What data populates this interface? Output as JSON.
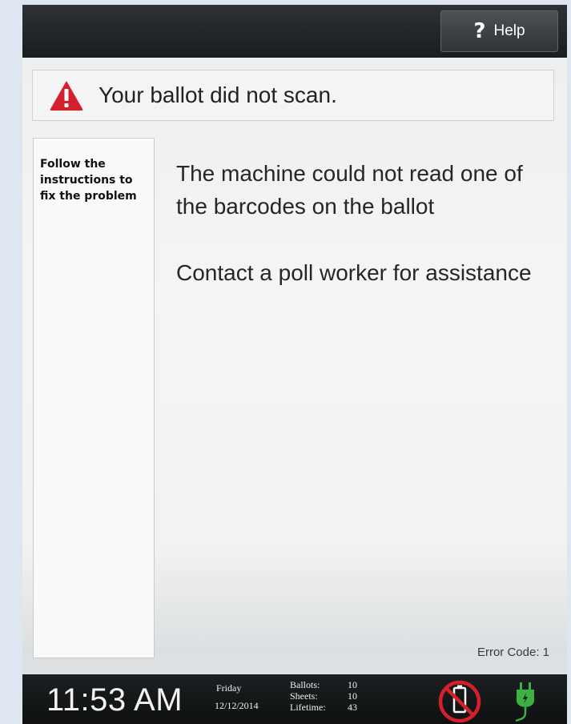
{
  "header": {
    "help_label": "Help",
    "help_icon_glyph": "?"
  },
  "status": {
    "message": "Your ballot did not scan.",
    "icon": "warning-triangle-icon",
    "icon_color": "#d4202a"
  },
  "sidebar": {
    "instruction": "Follow the instructions to fix the problem"
  },
  "main": {
    "paragraphs": [
      "The machine could not read one of the barcodes on the ballot",
      "Contact a poll worker for assistance"
    ]
  },
  "error_code": "Error Code: 1",
  "footer": {
    "time": "11:53 AM",
    "day": "Friday",
    "date": "12/12/2014",
    "counts": [
      {
        "label": "Ballots:",
        "value": "10"
      },
      {
        "label": "Sheets:",
        "value": "10"
      },
      {
        "label": "Lifetime:",
        "value": "43"
      }
    ],
    "battery_icon": "no-battery-icon",
    "battery_icon_color": "#d4202a",
    "power_icon": "power-plug-icon",
    "power_icon_color": "#3cb043"
  }
}
